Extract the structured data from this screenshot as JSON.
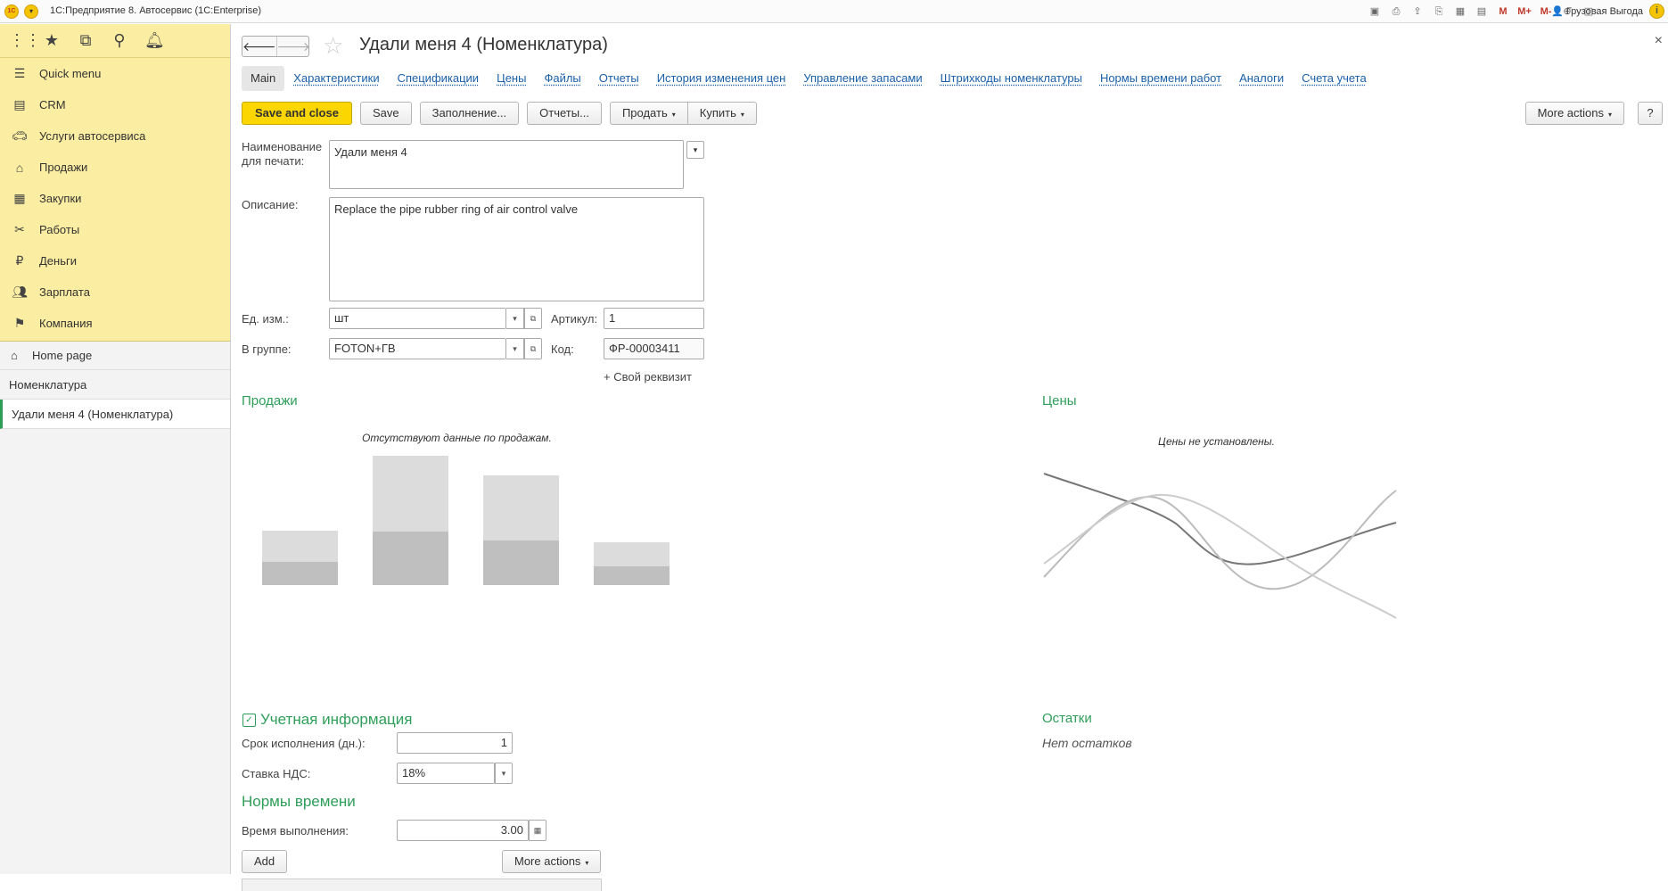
{
  "app": {
    "title": "1С:Предприятие 8. Автосервис  (1С:Enterprise)",
    "logo": "1С",
    "user": "Грузовая Выгода",
    "toolbar_icons": [
      "save-icon",
      "print-icon",
      "upload-icon",
      "print-preview-icon",
      "calculator-icon",
      "calendar-icon"
    ],
    "m_labels": [
      "M",
      "M+",
      "M-"
    ]
  },
  "sidebar": {
    "items": [
      {
        "label": "Quick menu",
        "icon": "menu-icon"
      },
      {
        "label": "CRM",
        "icon": "crm-icon"
      },
      {
        "label": "Услуги автосервиса",
        "icon": "car-icon"
      },
      {
        "label": "Продажи",
        "icon": "shop-icon"
      },
      {
        "label": "Закупки",
        "icon": "purchases-icon"
      },
      {
        "label": "Работы",
        "icon": "tools-icon"
      },
      {
        "label": "Деньги",
        "icon": "ruble-icon"
      },
      {
        "label": "Зарплата",
        "icon": "people-icon"
      },
      {
        "label": "Компания",
        "icon": "flag-icon"
      }
    ],
    "home": "Home page",
    "nomenclature": "Номенклатура",
    "opened": "Удали меня 4 (Номенклатура)"
  },
  "form": {
    "title": "Удали меня 4 (Номенклатура)",
    "tabs": [
      "Main",
      "Характеристики",
      "Спецификации",
      "Цены",
      "Файлы",
      "Отчеты",
      "История изменения цен",
      "Управление запасами",
      "Штрихкоды номенклатуры",
      "Нормы времени работ",
      "Аналоги",
      "Счета учета"
    ],
    "buttons": {
      "save_close": "Save and close",
      "save": "Save",
      "fill": "Заполнение...",
      "reports": "Отчеты...",
      "sell": "Продать",
      "buy": "Купить",
      "more": "More actions",
      "help": "?"
    },
    "fields": {
      "print_name_label": "Наименование для печати:",
      "print_name": "Удали меня 4",
      "desc_label": "Описание:",
      "desc": "Replace the pipe rubber ring of air control valve",
      "unit_label": "Ед. изм.:",
      "unit": "шт",
      "article_label": "Артикул:",
      "article": "1",
      "group_label": "В группе:",
      "group": "FOTON+ГВ",
      "code_label": "Код:",
      "code": "ФР-00003411",
      "add_attr": "+ Свой реквизит"
    },
    "sales": {
      "title": "Продажи",
      "note": "Отсутствуют данные по продажам."
    },
    "prices": {
      "title": "Цены",
      "note": "Цены не установлены."
    },
    "accounting": {
      "title": "Учетная информация",
      "term_label": "Срок исполнения (дн.):",
      "term": "1",
      "vat_label": "Ставка НДС:",
      "vat": "18%"
    },
    "stock": {
      "title": "Остатки",
      "note": "Нет остатков"
    },
    "time_norms": {
      "title": "Нормы времени",
      "time_label": "Время выполнения:",
      "time": "3.00",
      "add": "Add",
      "more": "More actions"
    }
  }
}
